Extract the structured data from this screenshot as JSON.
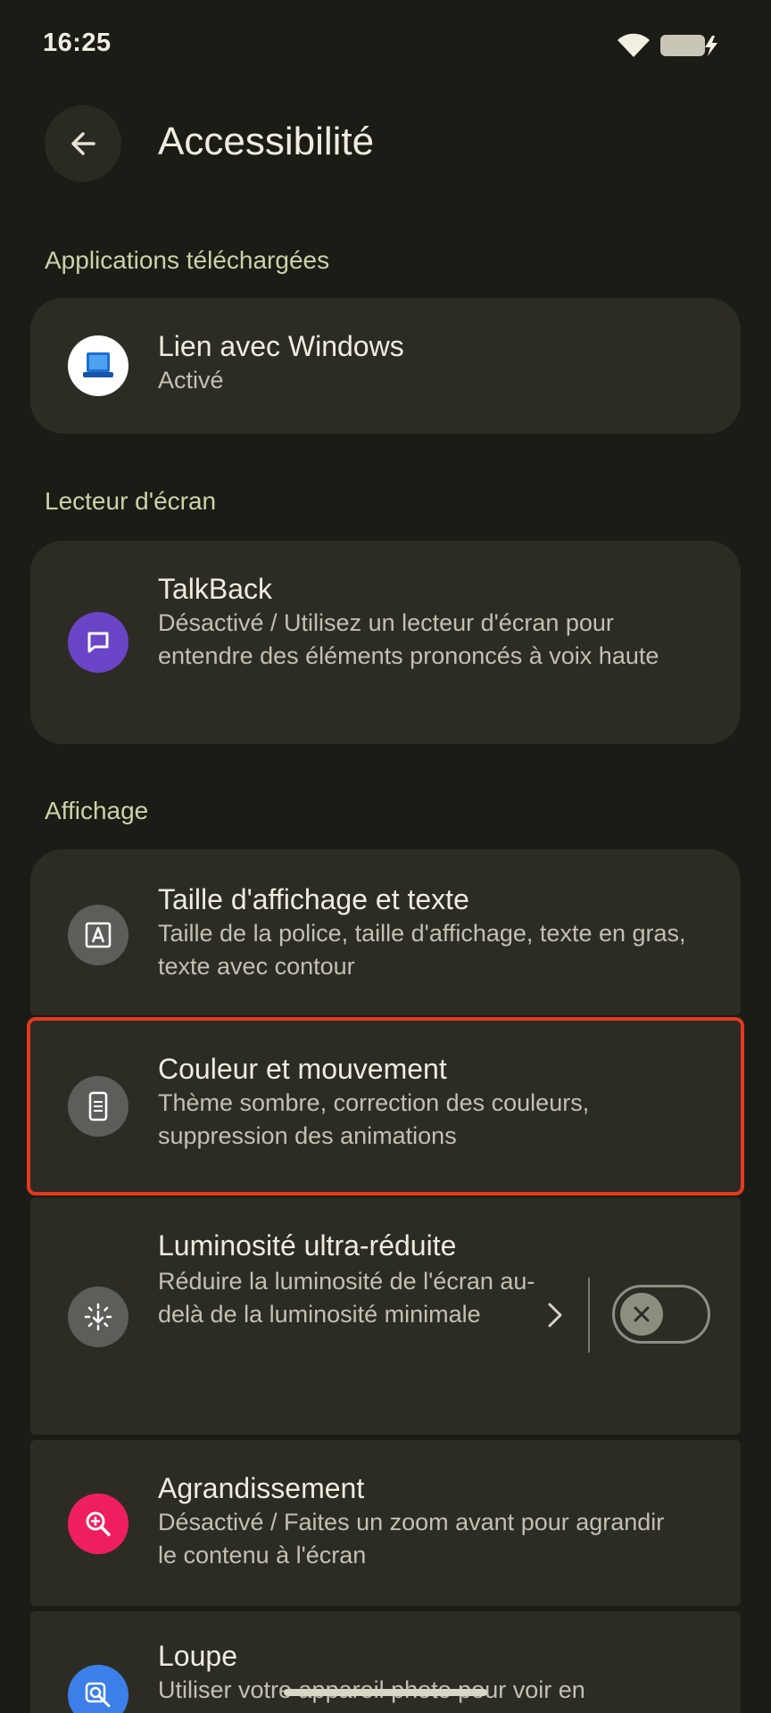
{
  "status_bar": {
    "time": "16:25"
  },
  "header": {
    "title": "Accessibilité"
  },
  "sections": {
    "downloaded": {
      "header": "Applications téléchargées",
      "item": {
        "title": "Lien avec Windows",
        "subtitle": "Activé"
      }
    },
    "screen_reader": {
      "header": "Lecteur d'écran",
      "item": {
        "title": "TalkBack",
        "subtitle": "Désactivé / Utilisez un lecteur d'écran pour entendre des éléments prononcés à voix haute"
      }
    },
    "display": {
      "header": "Affichage",
      "items": [
        {
          "title": "Taille d'affichage et texte",
          "subtitle": "Taille de la police, taille d'affichage, texte en gras, texte avec contour"
        },
        {
          "title": "Couleur et mouvement",
          "subtitle": "Thème sombre, correction des couleurs, suppression des animations"
        },
        {
          "title": "Luminosité ultra-réduite",
          "subtitle": "Réduire la luminosité de l'écran au-delà de la luminosité minimale",
          "toggle_on": false
        },
        {
          "title": "Agrandissement",
          "subtitle": "Désactivé / Faites un zoom avant pour agrandir le contenu à l'écran"
        },
        {
          "title": "Loupe",
          "subtitle": "Utiliser votre appareil photo pour voir en"
        }
      ]
    }
  },
  "colors": {
    "background": "#1c1c16",
    "card": "#2c2c24",
    "section_header": "#cdd2a8",
    "highlight_outline": "#e3391f",
    "talkback_icon": "#6a45c7",
    "magnification_icon": "#ef1f5f",
    "magnifier_icon": "#3d7fe8",
    "neutral_icon": "#5d5e5a"
  },
  "icons": {
    "back": "arrow-left-icon",
    "phone_link": "phone-link-app-icon",
    "talkback": "speech-bubble-icon",
    "display_size": "letter-a-icon",
    "color_motion": "phone-icon",
    "extra_dim": "dim-brightness-icon",
    "magnification": "zoom-in-icon",
    "magnifier": "magnifier-icon"
  }
}
